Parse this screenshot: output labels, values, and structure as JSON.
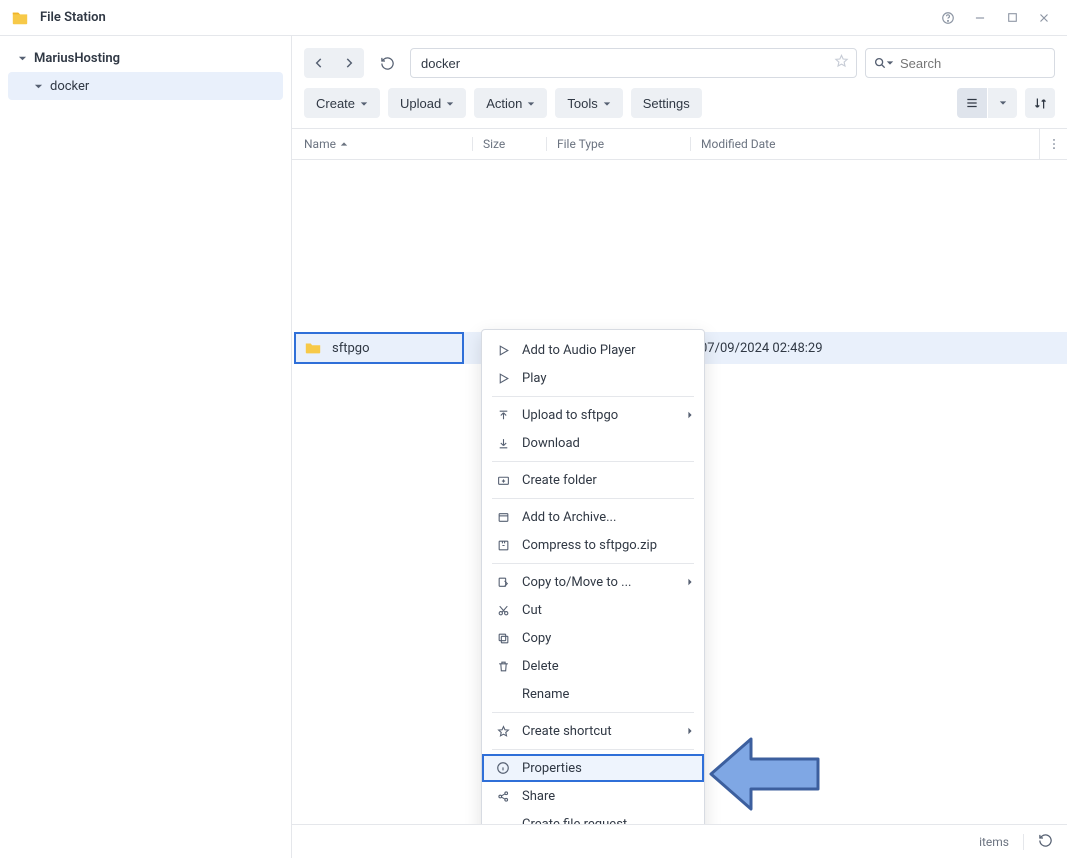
{
  "app": {
    "title": "File Station"
  },
  "sidebar": {
    "root": "MariusHosting",
    "child": "docker"
  },
  "path": {
    "value": "docker"
  },
  "search": {
    "placeholder": "Search"
  },
  "toolbar": {
    "create": "Create",
    "upload": "Upload",
    "action": "Action",
    "tools": "Tools",
    "settings": "Settings"
  },
  "columns": {
    "name": "Name",
    "size": "Size",
    "type": "File Type",
    "modified": "Modified Date"
  },
  "row": {
    "name": "sftpgo",
    "modified": "07/09/2024 02:48:29"
  },
  "ctx": {
    "addAudio": "Add to Audio Player",
    "play": "Play",
    "uploadTo": "Upload to sftpgo",
    "download": "Download",
    "createFolder": "Create folder",
    "addArchive": "Add to Archive...",
    "compress": "Compress to sftpgo.zip",
    "copyMove": "Copy to/Move to ...",
    "cut": "Cut",
    "copy": "Copy",
    "delete": "Delete",
    "rename": "Rename",
    "shortcut": "Create shortcut",
    "properties": "Properties",
    "share": "Share",
    "fileRequest": "Create file request"
  },
  "status": {
    "items": "items"
  }
}
